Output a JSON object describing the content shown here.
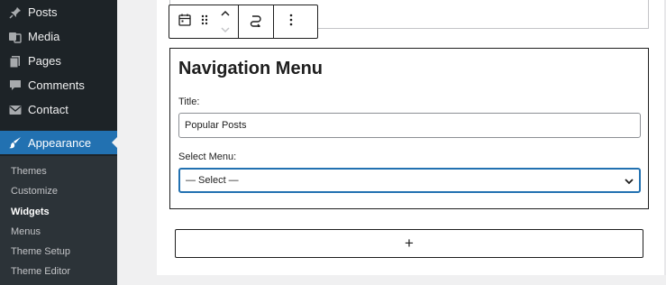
{
  "sidebar": {
    "items": [
      {
        "label": "Posts",
        "icon": "pin-icon"
      },
      {
        "label": "Media",
        "icon": "media-icon"
      },
      {
        "label": "Pages",
        "icon": "pages-icon"
      },
      {
        "label": "Comments",
        "icon": "comment-icon"
      },
      {
        "label": "Contact",
        "icon": "mail-icon"
      },
      {
        "label": "Appearance",
        "icon": "brush-icon"
      }
    ],
    "submenu": [
      {
        "label": "Themes"
      },
      {
        "label": "Customize"
      },
      {
        "label": "Widgets"
      },
      {
        "label": "Menus"
      },
      {
        "label": "Theme Setup"
      },
      {
        "label": "Theme Editor"
      }
    ]
  },
  "toolbar": {
    "icons": [
      "calendar-icon",
      "drag-handle-icon",
      "move-up-icon",
      "move-down-icon",
      "transform-icon",
      "more-options-icon"
    ]
  },
  "widget": {
    "title": "Navigation Menu",
    "title_label": "Title:",
    "title_value": "Popular Posts",
    "select_label": "Select Menu:",
    "select_value": "— Select —"
  },
  "add_block": {
    "icon": "plus-icon",
    "symbol": "+"
  },
  "colors": {
    "sidebar_bg": "#1d2327",
    "submenu_bg": "#2c3338",
    "accent": "#2271b1"
  }
}
